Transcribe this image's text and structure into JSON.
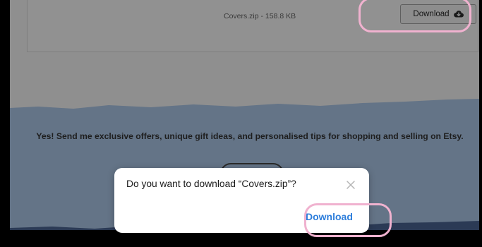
{
  "file": {
    "name_size": "Covers.zip - 158.8 KB",
    "download_label": "Download",
    "download_icon": "cloud-download-icon"
  },
  "offer": {
    "text": "Yes! Send me exclusive offers, unique gift ideas, and personalised tips for shopping and selling on Etsy."
  },
  "dialog": {
    "message": "Do you want to download “Covers.zip”?",
    "close_icon": "close-icon",
    "action_label": "Download",
    "action_color": "#2c7ddb"
  },
  "colors": {
    "dim_overlay": "#8f8f8f",
    "band_blue": "#647487",
    "footer_navy": "#2b3a55",
    "highlight_pink": "#f0b2cf"
  }
}
